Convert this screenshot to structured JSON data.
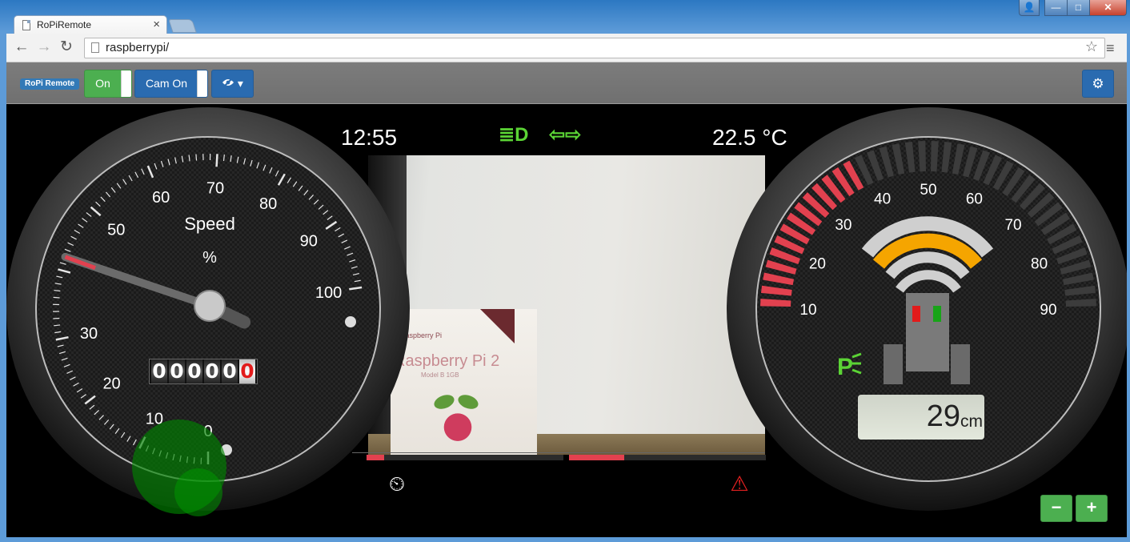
{
  "browser": {
    "tab_title": "RoPiRemote",
    "tab_close": "×",
    "url": "raspberrypi/",
    "nav_back": "←",
    "nav_forward": "→",
    "nav_reload": "↻",
    "bookmark_star": "☆",
    "menu": "≡",
    "window_controls": {
      "user": "👤",
      "minimize": "—",
      "maximize": "□",
      "close": "✕"
    }
  },
  "navbar": {
    "brand": "RoPi Remote",
    "power_toggle": "On",
    "cam_toggle": "Cam On",
    "view_dropdown_icon": "eye-slash-icon",
    "view_dropdown_caret": "▾",
    "settings_icon": "gear-icon",
    "settings_glyph": "⚙"
  },
  "dashboard": {
    "time": "12:55",
    "temperature": "22.5 °C",
    "headlight_icon": "headlight-icon",
    "headlight_glyph": "≣D",
    "blinker_glyph": "⇦⇨",
    "cruise_glyph": "⏲",
    "seatbelt_glyph": "⚠",
    "left_bar_level": 0.09,
    "right_bar_level": 0.28,
    "zoom_out": "−",
    "zoom_in": "+"
  },
  "speed_gauge": {
    "title": "Speed",
    "unit": "%",
    "labels": [
      "0",
      "10",
      "20",
      "30",
      "50",
      "60",
      "70",
      "80",
      "90",
      "100"
    ],
    "value": 42,
    "odometer": [
      "0",
      "0",
      "0",
      "0",
      "0",
      "0"
    ]
  },
  "distance_gauge": {
    "labels": [
      "10",
      "20",
      "30",
      "40",
      "50",
      "60",
      "70",
      "80",
      "90"
    ],
    "value": "29",
    "unit": "cm",
    "park_indicator": "P",
    "active_segments": 14,
    "total_segments": 40
  },
  "camera": {
    "box_brand": "Raspberry Pi",
    "box_title": "Raspberry Pi 2",
    "box_model": "Model B 1GB"
  },
  "colors": {
    "accent_blue": "#2a6bb0",
    "success_green": "#4caf50",
    "lamp_green": "#5bd435",
    "warning_red": "#e2414f",
    "arc_orange": "#f5a500"
  }
}
